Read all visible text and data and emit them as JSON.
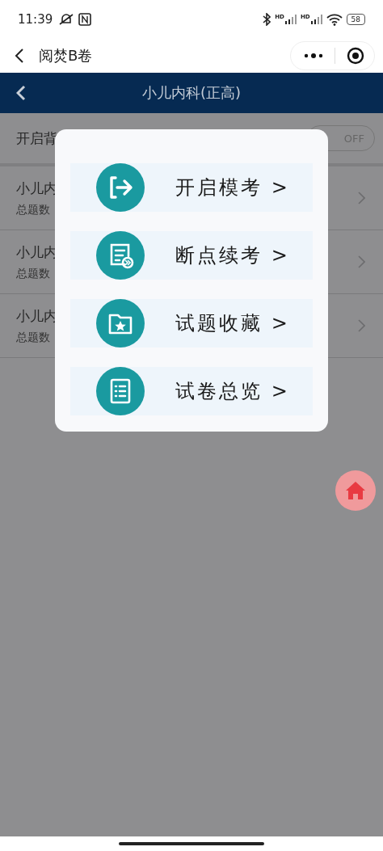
{
  "status_bar": {
    "time": "11:39",
    "signals": [
      {
        "label": "HD"
      },
      {
        "label": "HD"
      }
    ],
    "battery": "58"
  },
  "mini_nav": {
    "title": "阅焚B卷"
  },
  "header": {
    "title": "小儿内科(正高)"
  },
  "toggle_row": {
    "label": "开启背",
    "toggle": {
      "label": "OFF",
      "on": false
    }
  },
  "rows": [
    {
      "title": "小儿内",
      "subtitle": "总题数"
    },
    {
      "title": "小儿内",
      "subtitle": "总题数"
    },
    {
      "title": "小儿内",
      "subtitle": "总题数"
    }
  ],
  "menu": [
    {
      "kind": "start",
      "label": "开启模考 >"
    },
    {
      "kind": "resume",
      "label": "断点续考 >"
    },
    {
      "kind": "favorite",
      "label": "试题收藏 >"
    },
    {
      "kind": "overview",
      "label": "试卷总览 >"
    }
  ]
}
